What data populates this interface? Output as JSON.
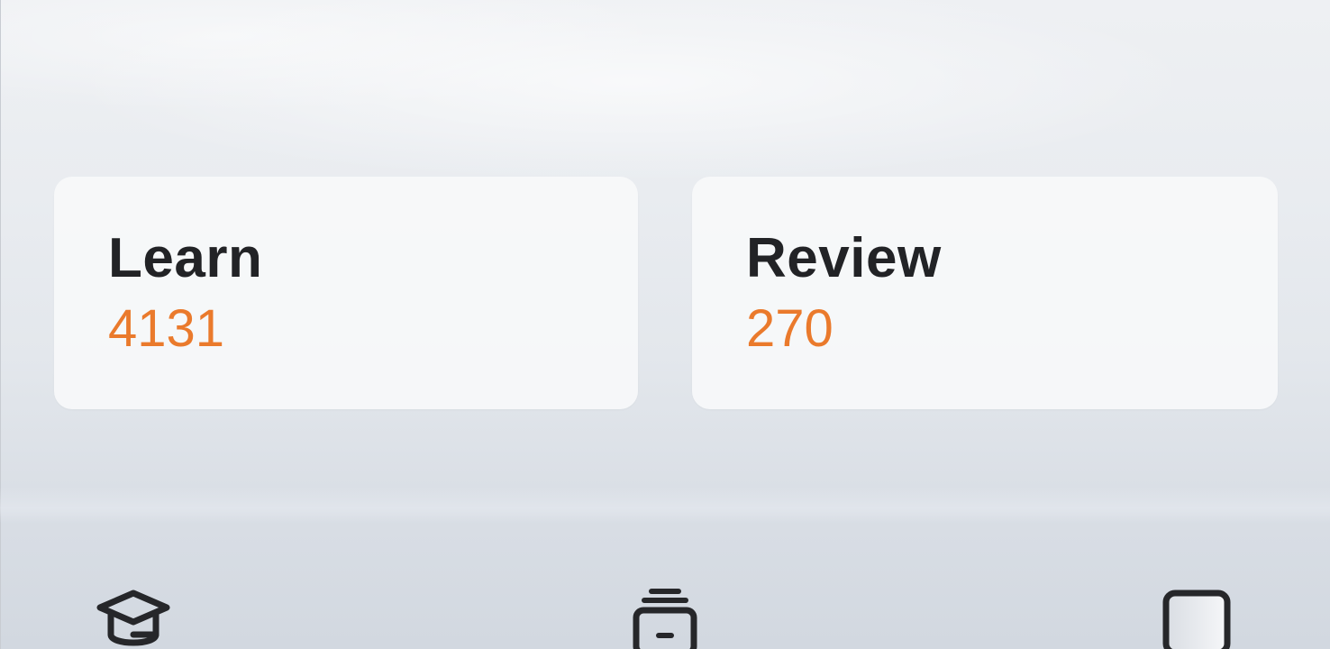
{
  "cards": {
    "learn": {
      "label": "Learn",
      "count": "4131"
    },
    "review": {
      "label": "Review",
      "count": "270"
    }
  },
  "colors": {
    "accent": "#ea7a2c",
    "title": "#222326",
    "card_bg": "#f7f8fa"
  },
  "tab_bar": {
    "items": [
      {
        "icon": "graduation-cap-icon"
      },
      {
        "icon": "card-stack-icon"
      },
      {
        "icon": "square-tile-icon"
      }
    ]
  }
}
